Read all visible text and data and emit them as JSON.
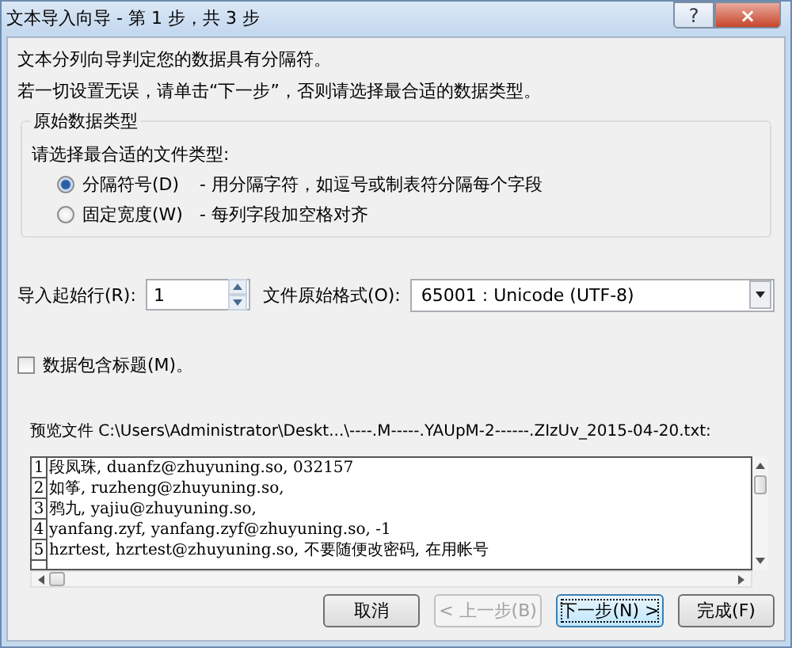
{
  "window": {
    "title": "文本导入向导 - 第 1 步，共 3 步",
    "help_button": "?",
    "close_button": "×"
  },
  "intro": [
    "文本分列向导判定您的数据具有分隔符。",
    "若一切设置无误，请单击“下一步”，否则请选择最合适的数据类型。"
  ],
  "data_type_group": {
    "title": "原始数据类型",
    "prompt": "请选择最合适的文件类型:",
    "options": [
      {
        "label": "分隔符号(D)",
        "description": "- 用分隔字符，如逗号或制表符分隔每个字段",
        "selected": true
      },
      {
        "label": "固定宽度(W)",
        "description": "- 每列字段加空格对齐",
        "selected": false
      }
    ]
  },
  "start_row": {
    "label": "导入起始行(R):",
    "value": "1"
  },
  "file_origin": {
    "label": "文件原始格式(O):",
    "value": "65001 : Unicode (UTF-8)"
  },
  "headers_checkbox": {
    "label": "数据包含标题(M)。",
    "checked": false
  },
  "preview": {
    "label": "预览文件 C:\\Users\\Administrator\\Deskt...\\----.M-----.YAUpM-2------.ZIzUv_2015-04-20.txt:",
    "rows": [
      {
        "number": "1",
        "text": "段凤珠, duanfz@zhuyuning.so, 032157"
      },
      {
        "number": "2",
        "text": "如筝, ruzheng@zhuyuning.so,"
      },
      {
        "number": "3",
        "text": "鸦九, yajiu@zhuyuning.so,"
      },
      {
        "number": "4",
        "text": "yanfang.zyf, yanfang.zyf@zhuyuning.so, -1"
      },
      {
        "number": "5",
        "text": "hzrtest, hzrtest@zhuyuning.so, 不要随便改密码, 在用帐号"
      }
    ]
  },
  "buttons": [
    {
      "label": "取消",
      "disabled": false,
      "default": false
    },
    {
      "label": "< 上一步(B)",
      "disabled": true,
      "default": false
    },
    {
      "label": "下一步(N) >",
      "disabled": false,
      "default": true
    },
    {
      "label": "完成(F)",
      "disabled": false,
      "default": false
    }
  ]
}
